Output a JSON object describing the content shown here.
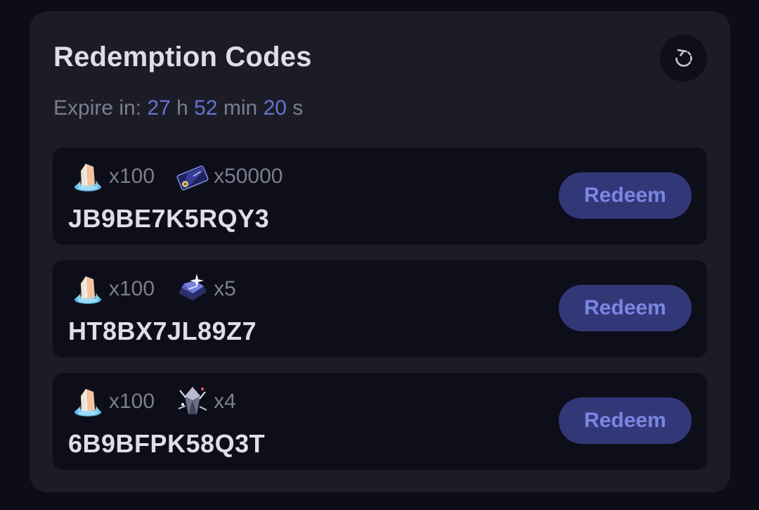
{
  "panel": {
    "title": "Redemption Codes",
    "refresh_icon": "refresh-icon"
  },
  "expiry": {
    "prefix": "Expire in:",
    "hours": "27",
    "hours_unit": "h",
    "minutes": "52",
    "minutes_unit": "min",
    "seconds": "20",
    "seconds_unit": "s"
  },
  "codes": [
    {
      "code": "JB9BE7K5RQY3",
      "redeem_label": "Redeem",
      "rewards": [
        {
          "icon": "stellar-jade-icon",
          "qty": "x100"
        },
        {
          "icon": "credit-card-icon",
          "qty": "x50000"
        }
      ]
    },
    {
      "code": "HT8BX7JL89Z7",
      "redeem_label": "Redeem",
      "rewards": [
        {
          "icon": "stellar-jade-icon",
          "qty": "x100"
        },
        {
          "icon": "exp-book-icon",
          "qty": "x5"
        }
      ]
    },
    {
      "code": "6B9BFPK58Q3T",
      "redeem_label": "Redeem",
      "rewards": [
        {
          "icon": "stellar-jade-icon",
          "qty": "x100"
        },
        {
          "icon": "refine-crystal-icon",
          "qty": "x4"
        }
      ]
    }
  ],
  "colors": {
    "background": "#0d0d19",
    "card": "#1b1c27",
    "row": "#0e0e1a",
    "accent": "#6673cf",
    "button_bg": "#323877",
    "button_text": "#7a86e4",
    "text_primary": "#dedfe6",
    "text_muted": "#7c7e8d"
  }
}
